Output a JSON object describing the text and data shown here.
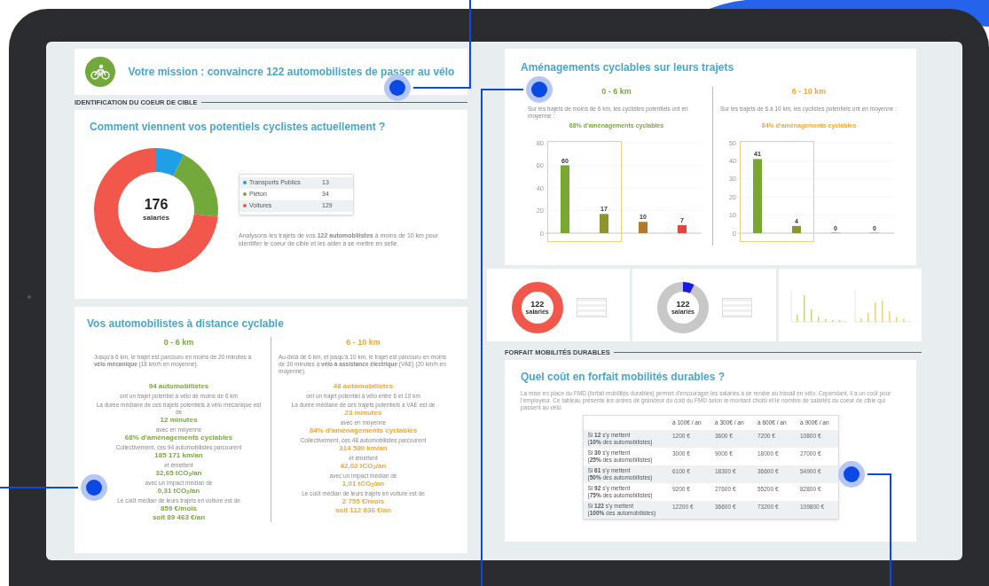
{
  "header": {
    "title": "Votre mission : convaincre 122 automobilistes de passer au vélo"
  },
  "target_section": {
    "label": "IDENTIFICATION DU COEUR DE CIBLE"
  },
  "modes": {
    "title": "Comment viennent vos potentiels cyclistes actuellement ?",
    "center_value": "176",
    "center_label": "salariés",
    "slices": [
      {
        "color": "#1e9fe6"
      },
      {
        "color": "#72a93a"
      },
      {
        "color": "#f2574b"
      }
    ],
    "legend": [
      {
        "value": "13"
      },
      {
        "value": "34"
      },
      {
        "value": "129"
      }
    ],
    "chart_data": {
      "type": "donut",
      "categories": [
        "Transports Publics",
        "Piéton",
        "Voitures"
      ],
      "values": [
        7.4,
        19.3,
        73.3
      ],
      "legend": "right"
    },
    "note": "Analysons les trajets de vos **122 automobilistes** à moins de 10 km pour identifier le coeur de cible et les aider à se mettre en selle."
  },
  "distance": {
    "title": "Vos automobilistes à distance cyclable",
    "columns": [
      {
        "range": "0 - 6 km",
        "color": "#7aa83a",
        "intro": "Jusqu'à 6 km, le trajet est parcouru en moins de 20 minutes à **vélo mécanique** (18 km/h en moyenne).",
        "lines": [
          {
            "kind": "value",
            "text": "94 automobilistes"
          },
          {
            "kind": "note",
            "text": "ont un trajet potentiel à vélo de moins de 6 km"
          },
          {
            "kind": "note",
            "text": "La durée médiane de ces trajets potentiels à vélo mécanique est de"
          },
          {
            "kind": "value",
            "text": "12 minutes"
          },
          {
            "kind": "note",
            "text": "avec en moyenne"
          },
          {
            "kind": "value",
            "text": "68% d'aménagements cyclables"
          },
          {
            "kind": "note",
            "text": "Collectivement, ces 94 automobilistes parcourent"
          },
          {
            "kind": "value",
            "text": "185 171 km/an"
          },
          {
            "kind": "note",
            "text": "et émettent"
          },
          {
            "kind": "value",
            "text": "32,65 tCO$_{2}$/an"
          },
          {
            "kind": "note",
            "text": "avec un impact médian de"
          },
          {
            "kind": "value",
            "text": "0,31 tCO$_{2}$/an"
          },
          {
            "kind": "note",
            "text": "Le coût médian de leurs trajets en voiture est de"
          },
          {
            "kind": "value",
            "text": "859 €/mois"
          },
          {
            "kind": "value",
            "text": "soit 89 463 €/an"
          }
        ]
      },
      {
        "range": "6 - 10 km",
        "color": "#f0a830",
        "intro": "Au-delà de 6 km, et jusqu'à 10 km, le trajet est parcouru en moins de 30 minutes à **vélo à assistance électrique** (VAE) (20 km/h en moyenne).",
        "lines": [
          {
            "kind": "value",
            "text": "48 automobilistes"
          },
          {
            "kind": "note",
            "text": "ont un trajet potentiel à vélo entre 6 et 10 km"
          },
          {
            "kind": "note",
            "text": "La durée médiane de ces trajets potentiels à VAE est de"
          },
          {
            "kind": "value",
            "text": "23 minutes"
          },
          {
            "kind": "note",
            "text": "avec en moyenne"
          },
          {
            "kind": "value",
            "text": "84% d'aménagements cyclables"
          },
          {
            "kind": "note",
            "text": "Collectivement, ces 48 automobilistes parcourent"
          },
          {
            "kind": "value",
            "text": "314 580 km/an"
          },
          {
            "kind": "note",
            "text": "et émettent"
          },
          {
            "kind": "value",
            "text": "42,02 tCO$_{2}$/an"
          },
          {
            "kind": "note",
            "text": "avec un impact médian de"
          },
          {
            "kind": "value",
            "text": "1,01 tCO$_{2}$/an"
          },
          {
            "kind": "note",
            "text": "Le coût médian de leurs trajets en voiture est de"
          },
          {
            "kind": "value",
            "text": "2 755 €/mois"
          },
          {
            "kind": "value",
            "text": "soit 112 836 €/an"
          }
        ]
      }
    ]
  },
  "facilities": {
    "title": "Aménagements cyclables sur leurs trajets",
    "columns": [
      {
        "range": "0 - 6 km",
        "color": "#7aa83a",
        "intro": "Sur les trajets de moins de 6 km, les cyclistes potentiels ont en moyenne :",
        "highlight": "68% d'aménagements cyclables",
        "bars": [
          {
            "color": "#78a832"
          },
          {
            "color": "#8e952c"
          },
          {
            "color": "#b07a2e"
          },
          {
            "color": "#e2453b"
          }
        ],
        "chart_data": {
          "type": "bar",
          "categories": [
            null,
            null,
            null,
            null
          ],
          "values": [
            60,
            17,
            10,
            7
          ],
          "ylim": [
            0,
            80
          ],
          "yticks": [
            0,
            20,
            40,
            60,
            80
          ],
          "grid": true,
          "data_labels": true
        }
      },
      {
        "range": "6 - 10 km",
        "color": "#f0a830",
        "intro": "Sur les trajets de 6 à 10 km, les cyclistes potentiels ont en moyenne :",
        "highlight": "84% d'aménagements cyclables",
        "bars": [
          {
            "color": "#78a832"
          },
          {
            "color": "#8e952c"
          }
        ],
        "chart_data": {
          "type": "bar",
          "categories": [
            null,
            null,
            null,
            null
          ],
          "values": [
            41,
            4,
            0,
            0
          ],
          "ylim": [
            0,
            50
          ],
          "yticks": [
            0,
            10,
            20,
            30,
            40,
            50
          ],
          "grid": true,
          "data_labels": true
        }
      }
    ]
  },
  "mini_panels": [
    {
      "kind": "donut",
      "center_value": "122",
      "center_label": "salariés"
    },
    {
      "kind": "donut",
      "center_value": "122",
      "center_label": "salariés"
    },
    {
      "kind": "bars"
    }
  ],
  "fmd": {
    "section_label": "FORFAIT MOBILITÉS DURABLES",
    "title": "Quel coût en forfait mobilités durables ?",
    "paragraph": "La mise en place du FMD (forfait mobilités durables) permet d'encourager les salariés à se rendre au travail en vélo. Cependant, il a un coût pour l'employeur. Ce tableau présente les ordres de grandeur du coût du FMD selon le montant choisi et le nombre de salariés du coeur de cible qui passent au vélo.",
    "columns": [
      "à 100€ / an",
      "à 300€ / an",
      "à 600€ / an",
      "à 900€ / an"
    ],
    "rows": [
      {
        "label": "Si **12** s'y mettent",
        "sub": "(**10%** des automobilistes)",
        "cells": [
          "1200 €",
          "3600 €",
          "7200 €",
          "10800 €"
        ]
      },
      {
        "label": "Si **30** s'y mettent",
        "sub": "(**25%** des automobilistes)",
        "cells": [
          "3000 €",
          "9000 €",
          "18000 €",
          "27000 €"
        ]
      },
      {
        "label": "Si **61** s'y mettent",
        "sub": "(**50%** des automobilistes)",
        "cells": [
          "6100 €",
          "18300 €",
          "36600 €",
          "54900 €"
        ]
      },
      {
        "label": "Si **92** s'y mettent",
        "sub": "(**75%** des automobilistes)",
        "cells": [
          "9200 €",
          "27600 €",
          "55200 €",
          "82800 €"
        ]
      },
      {
        "label": "Si **122** s'y mettent",
        "sub": "(**100%** des automobilistes)",
        "cells": [
          "12200 €",
          "36600 €",
          "73200 €",
          "109800 €"
        ]
      }
    ]
  }
}
